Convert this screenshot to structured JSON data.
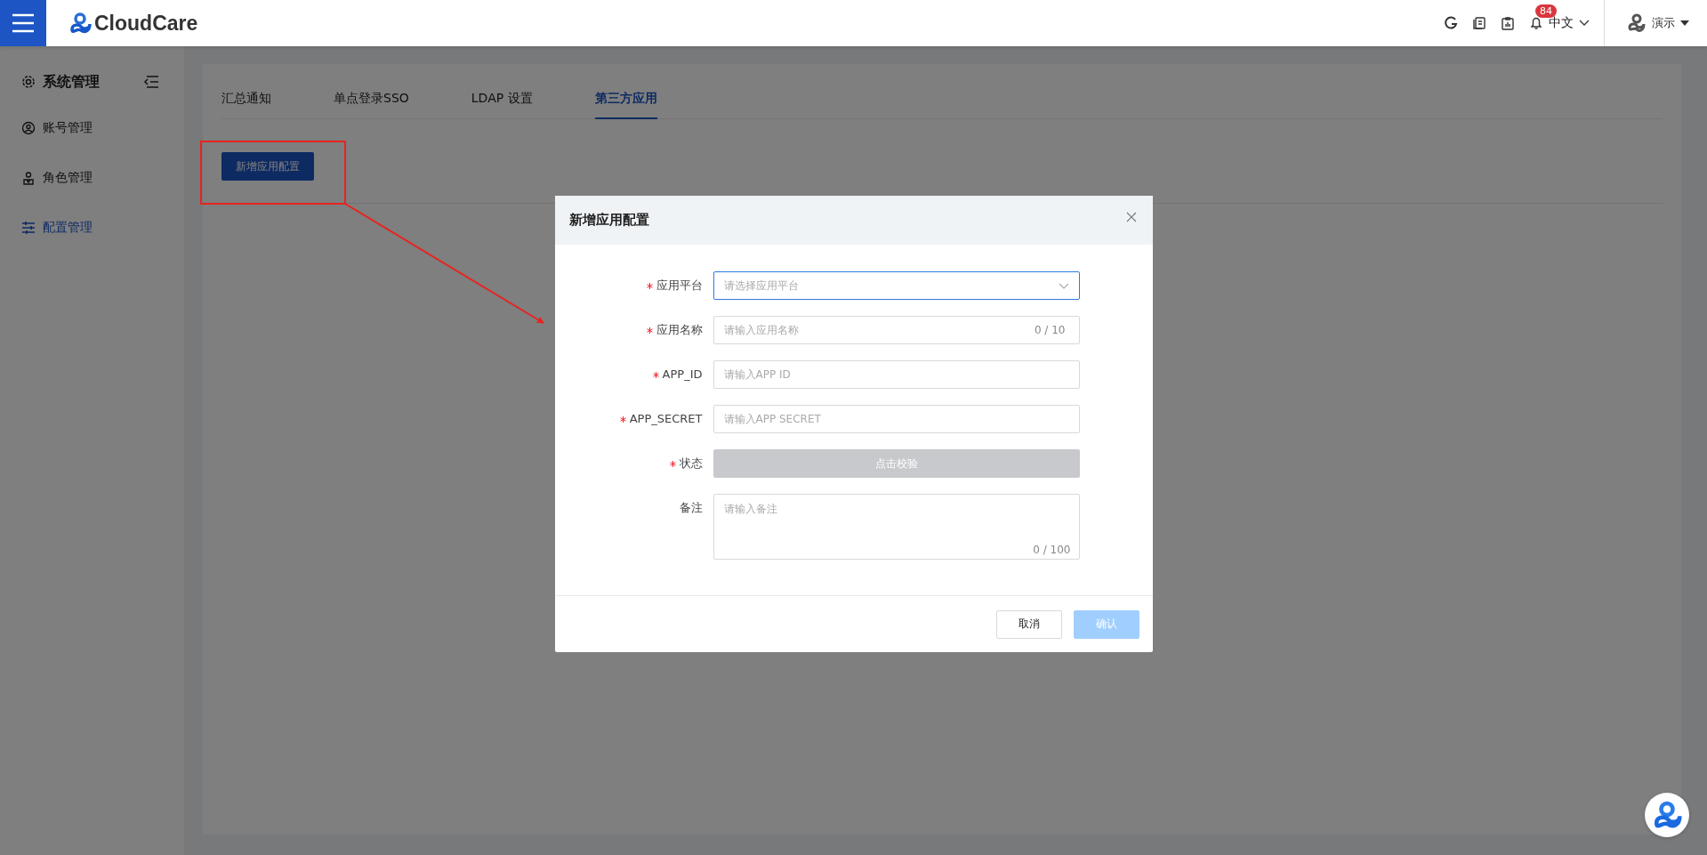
{
  "header": {
    "logo_text": "CloudCare",
    "notification_count": "84",
    "language": "中文",
    "user": "演示"
  },
  "sidebar": {
    "title": "系统管理",
    "items": [
      {
        "label": "账号管理",
        "selected": false
      },
      {
        "label": "角色管理",
        "selected": false
      },
      {
        "label": "配置管理",
        "selected": true
      }
    ]
  },
  "tabs": [
    {
      "label": "汇总通知",
      "selected": false
    },
    {
      "label": "单点登录SSO",
      "selected": false
    },
    {
      "label": "LDAP 设置",
      "selected": false
    },
    {
      "label": "第三方应用",
      "selected": true
    }
  ],
  "add_button": "新增应用配置",
  "dialog": {
    "title": "新增应用配置",
    "fields": [
      {
        "kind": "select",
        "label": "应用平台",
        "required": true,
        "placeholder": "请选择应用平台",
        "focused": true
      },
      {
        "kind": "input",
        "label": "应用名称",
        "required": true,
        "placeholder": "请输入应用名称",
        "counter": "0 / 10",
        "focused": false
      },
      {
        "kind": "input",
        "label": "APP_ID",
        "required": true,
        "placeholder": "请输入APP ID",
        "focused": false
      },
      {
        "kind": "input",
        "label": "APP_SECRET",
        "required": true,
        "placeholder": "请输入APP SECRET",
        "focused": false
      },
      {
        "kind": "button",
        "label": "状态",
        "required": true,
        "button": "点击校验"
      },
      {
        "kind": "textarea",
        "label": "备注",
        "required": false,
        "placeholder": "请输入备注",
        "counter": "0 / 100",
        "focused": false
      }
    ],
    "buttons": [
      {
        "label": "取消",
        "kind": "default",
        "disabled": false
      },
      {
        "label": "确认",
        "kind": "primary",
        "disabled": true
      }
    ]
  }
}
